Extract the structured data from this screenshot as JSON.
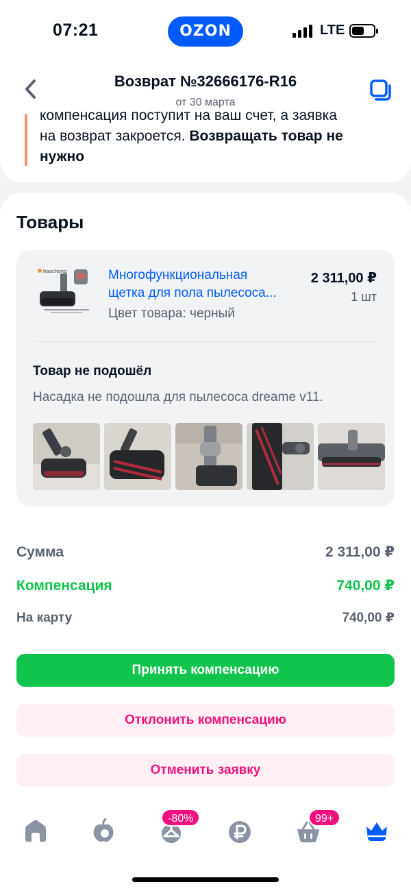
{
  "status_bar": {
    "time": "07:21",
    "brand": "OZON",
    "network": "LTE"
  },
  "header": {
    "title": "Возврат №32666176-R16",
    "subtitle": "от 30 марта",
    "back_icon": "chevron-left-icon",
    "copy_icon": "copy-icon"
  },
  "notice": {
    "line_cut": "компенсация поступит на ваш счет, а заявка",
    "text_plain": "на возврат закроется. ",
    "text_bold": "Возвращать товар не нужно",
    "accent_color": "#f1906e"
  },
  "goods": {
    "section_title": "Товары",
    "product": {
      "name": "Многофункциональная\nщетка для пола пылесоса...",
      "price": "2 311,00 ₽",
      "quantity": "1 шт",
      "color": "Цвет товара: черный",
      "thumb_brand": "haochong"
    },
    "reason_title": "Товар не подошёл",
    "reason_text": "Насадка не подошла для пылесоса dreame v11.",
    "photos_count": 5
  },
  "summary": {
    "sum_label": "Сумма",
    "sum_value": "2 311,00 ₽",
    "compensation_label": "Компенсация",
    "compensation_value": "740,00 ₽",
    "card_label": "На карту",
    "card_value": "740,00 ₽"
  },
  "actions": {
    "accept": "Принять компенсацию",
    "decline": "Отклонить компенсацию",
    "cancel": "Отменить заявку"
  },
  "bottom_nav": {
    "items": [
      {
        "name": "home",
        "icon": "home-icon"
      },
      {
        "name": "fresh",
        "icon": "apple-icon"
      },
      {
        "name": "sale",
        "icon": "hanger-icon",
        "badge": "-80%"
      },
      {
        "name": "bank",
        "icon": "ruble-icon"
      },
      {
        "name": "cart",
        "icon": "basket-icon",
        "badge": "99+"
      },
      {
        "name": "profile",
        "icon": "crown-icon"
      }
    ]
  },
  "colors": {
    "brand_blue": "#005bff",
    "green": "#10c44c",
    "pink": "#f1117e"
  }
}
